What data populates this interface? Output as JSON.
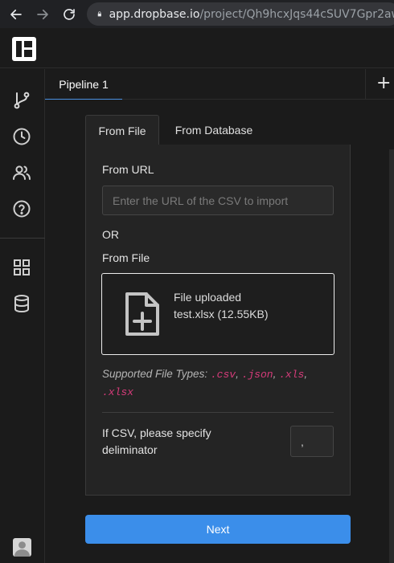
{
  "browser": {
    "url_host": "app.dropbase.io",
    "url_path": "/project/Qh9hcxJqs44cSUV7Gpr2aw"
  },
  "icons": {
    "back": "arrow-left-icon",
    "forward": "arrow-right-icon",
    "reload": "reload-icon",
    "lock": "lock-icon",
    "logo": "dropbase-logo",
    "pipeline": "git-branch-icon",
    "history": "clock-icon",
    "users": "users-icon",
    "help": "help-circle-icon",
    "apps": "grid-icon",
    "database": "database-icon",
    "add": "plus-icon",
    "file": "file-plus-icon",
    "avatar": "user-avatar"
  },
  "tabs": {
    "pipeline_label": "Pipeline 1",
    "add_label": "+"
  },
  "source_tabs": {
    "from_file": "From File",
    "from_database": "From Database"
  },
  "form": {
    "url_label": "From URL",
    "url_placeholder": "Enter the URL of the CSV to import",
    "or_label": "OR",
    "file_label": "From File",
    "upload_status": "File uploaded",
    "uploaded_file": "test.xlsx (12.55KB)",
    "supported_prefix": "Supported File Types:",
    "types": [
      ".csv",
      ".json",
      ".xls",
      ".xlsx"
    ],
    "csv_label": "If CSV, please specify deliminator",
    "delimiter_value": ","
  },
  "actions": {
    "next_label": "Next"
  },
  "colors": {
    "accent": "#3b8eea",
    "file_type": "#d63b7a",
    "background": "#1b1b1b",
    "panel": "#242424"
  }
}
